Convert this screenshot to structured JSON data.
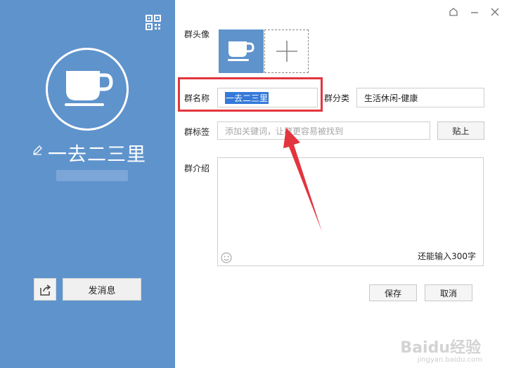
{
  "sidebar": {
    "group_name": "一去二三里",
    "send_message_label": "发消息"
  },
  "form": {
    "avatar_label": "群头像",
    "name_label": "群名称",
    "name_value": "一去二三里",
    "category_label": "群分类",
    "category_value": "生活休闲-健康",
    "tags_label": "群标签",
    "tags_placeholder": "添加关键词，让群更容易被找到",
    "paste_label": "贴上",
    "intro_label": "群介绍",
    "intro_counter": "还能输入300字",
    "save_label": "保存",
    "cancel_label": "取消"
  },
  "watermark": {
    "brand": "Baidu经验",
    "url": "jingyan.baidu.com"
  },
  "colors": {
    "sidebar_bg": "#5f93cc",
    "highlight": "#e2353d",
    "selection": "#3579d9"
  },
  "icons": [
    "qr-code-icon",
    "coffee-cup-icon",
    "edit-icon",
    "share-icon",
    "plus-icon",
    "skin-icon",
    "minimize-icon",
    "close-icon",
    "emoji-icon"
  ]
}
